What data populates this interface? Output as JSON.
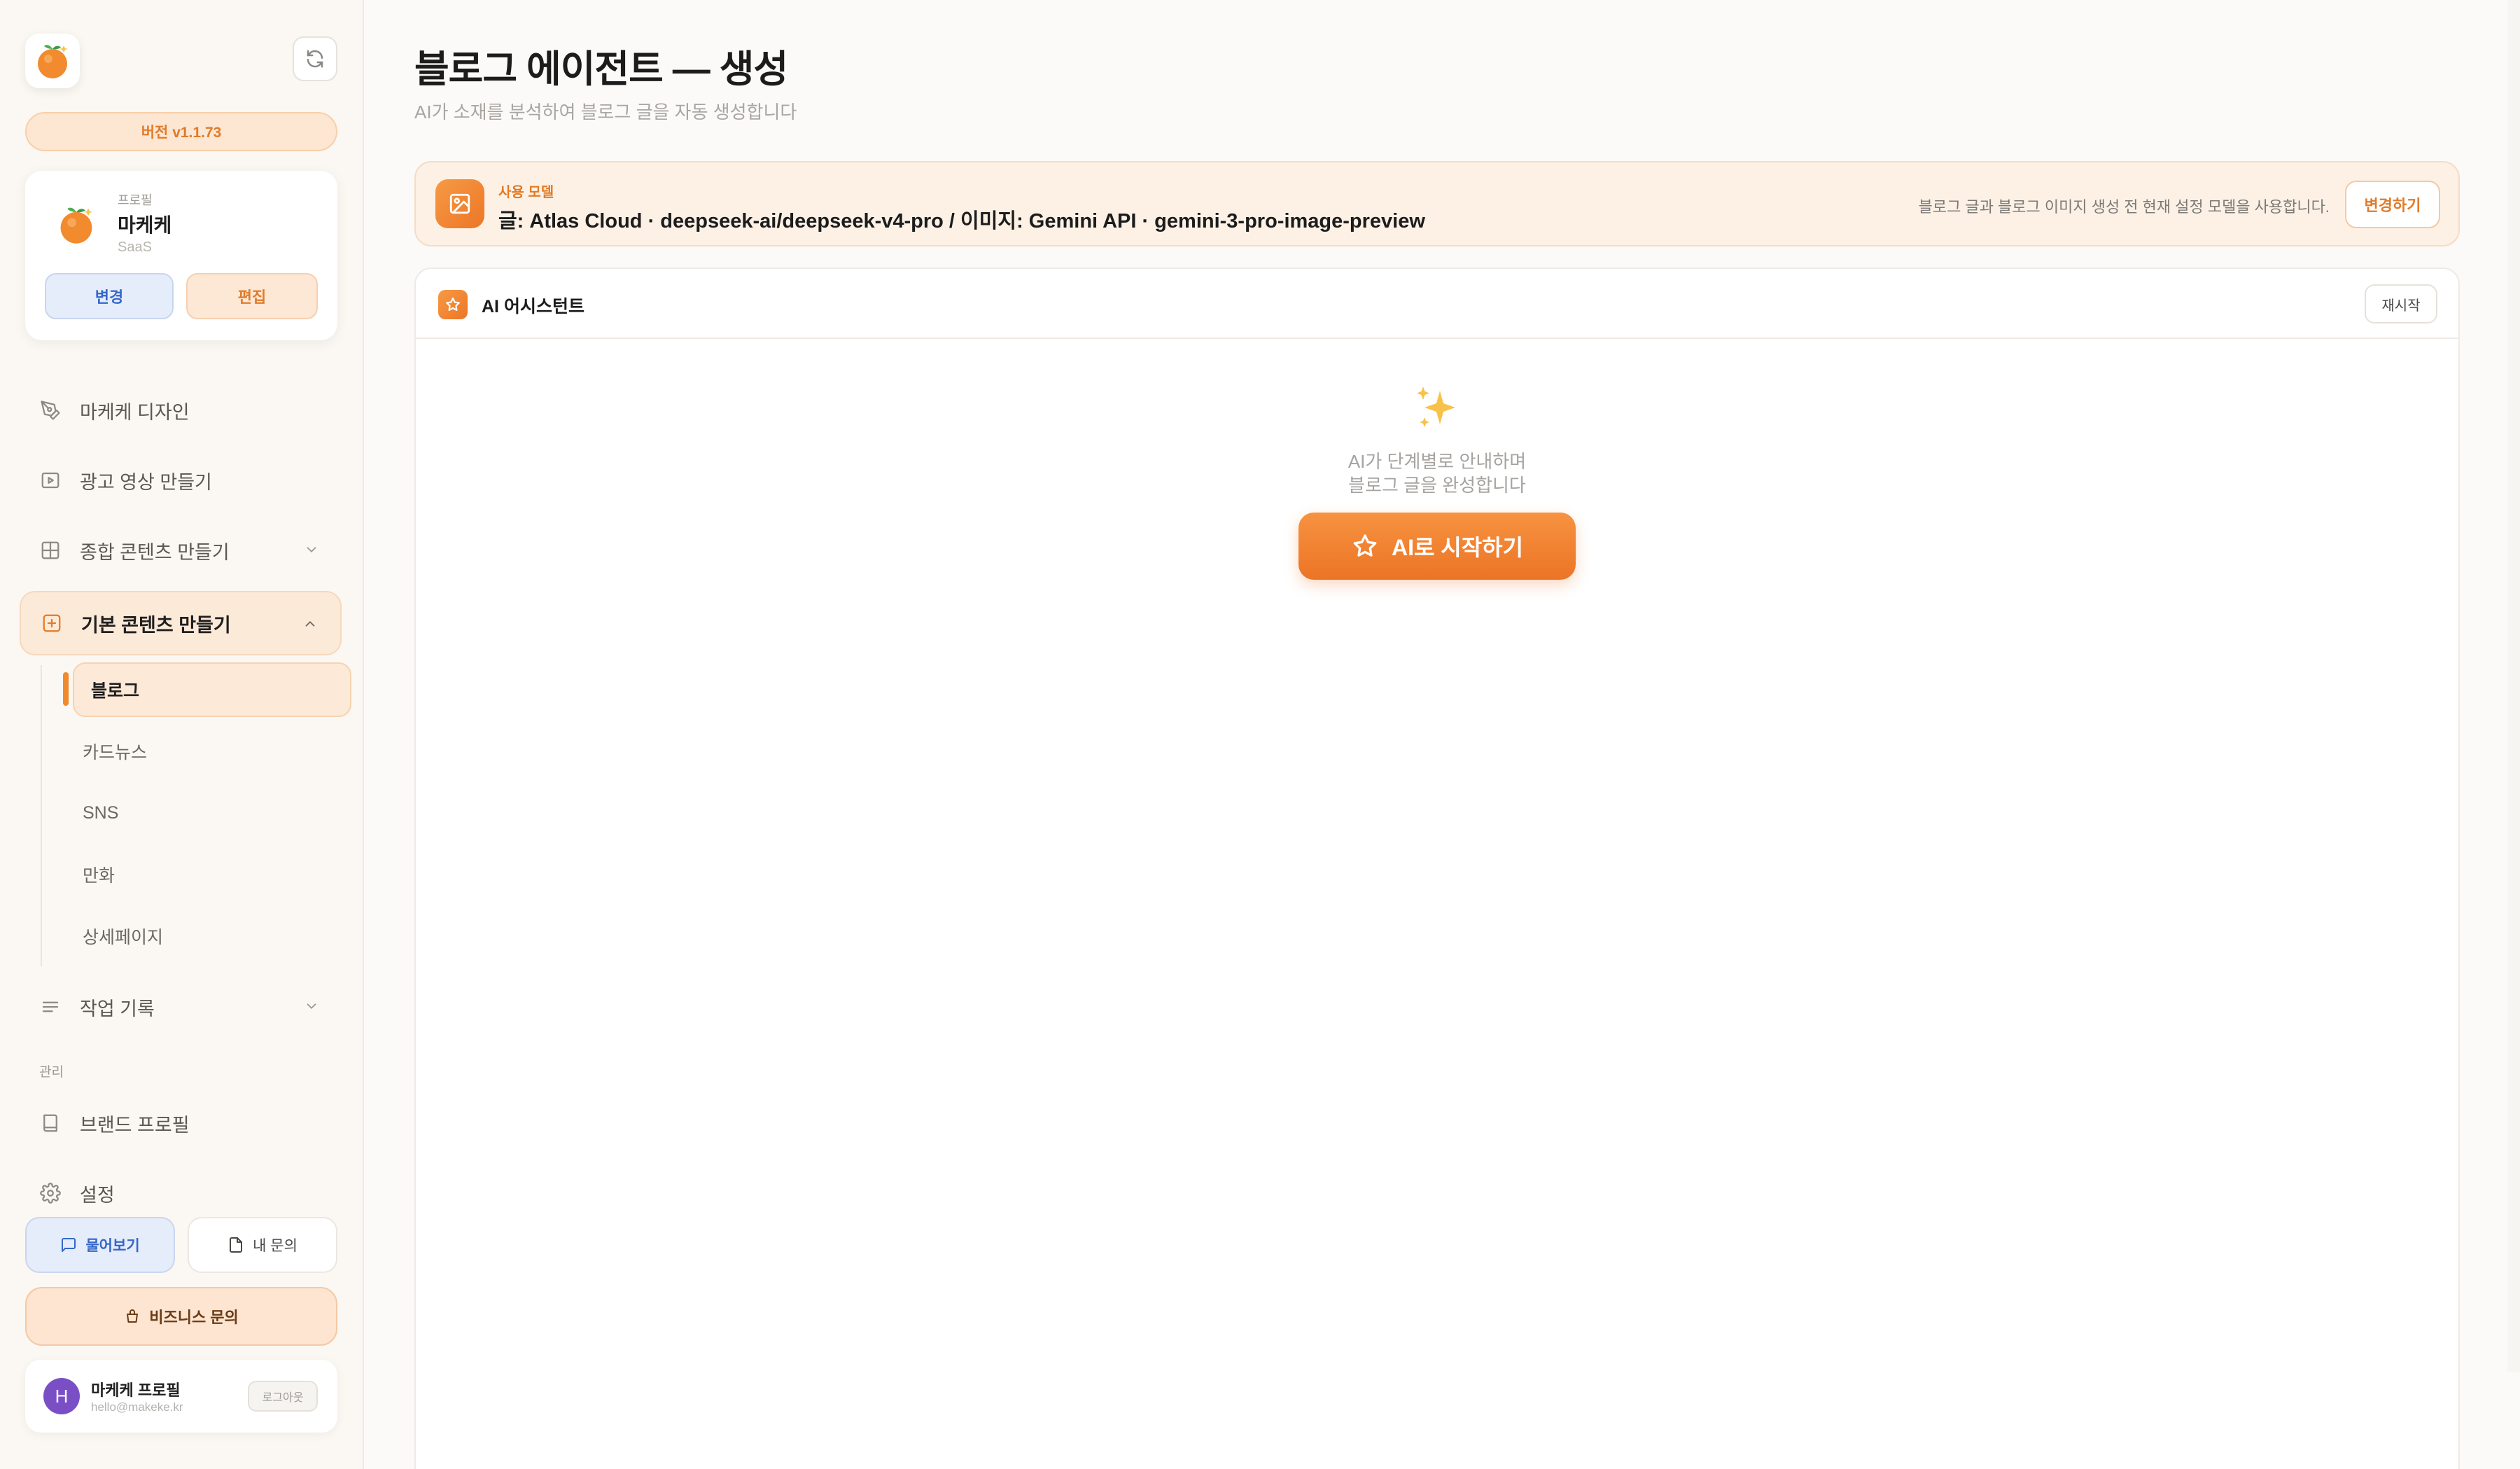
{
  "sidebar": {
    "version": "버전 v1.1.73",
    "profile": {
      "eyebrow": "프로필",
      "name": "마케케",
      "type": "SaaS",
      "change_label": "변경",
      "edit_label": "편집"
    },
    "nav": [
      {
        "label": "마케케 디자인",
        "icon": "pen-tool-icon"
      },
      {
        "label": "광고 영상 만들기",
        "icon": "video-icon"
      },
      {
        "label": "종합 콘텐츠 만들기",
        "icon": "grid-icon"
      },
      {
        "label": "기본 콘텐츠 만들기",
        "icon": "plus-square-icon"
      }
    ],
    "sub_items": [
      "블로그",
      "카드뉴스",
      "SNS",
      "만화",
      "상세페이지"
    ],
    "history_label": "작업 기록",
    "section_caption": "관리",
    "brand_profile_label": "브랜드 프로필",
    "settings_label": "설정",
    "ask_label": "물어보기",
    "my_questions_label": "내 문의",
    "business_label": "비즈니스 문의",
    "user": {
      "initial": "H",
      "name": "마케케 프로필",
      "email": "hello@makeke.kr",
      "logout_label": "로그아웃"
    }
  },
  "main": {
    "title": "블로그 에이전트 — 생성",
    "subtitle": "AI가 소재를 분석하여 블로그 글을 자동 생성합니다",
    "model_bar": {
      "eyebrow": "사용 모델",
      "value": "글: Atlas Cloud · deepseek-ai/deepseek-v4-pro / 이미지: Gemini API · gemini-3-pro-image-preview",
      "note": "블로그 글과 블로그 이미지 생성 전 현재 설정 모델을 사용합니다.",
      "change_label": "변경하기"
    },
    "assistant": {
      "title": "AI 어시스턴트",
      "restart_label": "재시작",
      "empty_line1": "AI가 단계별로 안내하며",
      "empty_line2": "블로그 글을 완성합니다",
      "start_label": "AI로 시작하기"
    }
  },
  "colors": {
    "accent": "#ec7626",
    "accent_light": "#fde9d7",
    "blue_button": "#3567c8",
    "avatar": "#7a4fc6"
  }
}
